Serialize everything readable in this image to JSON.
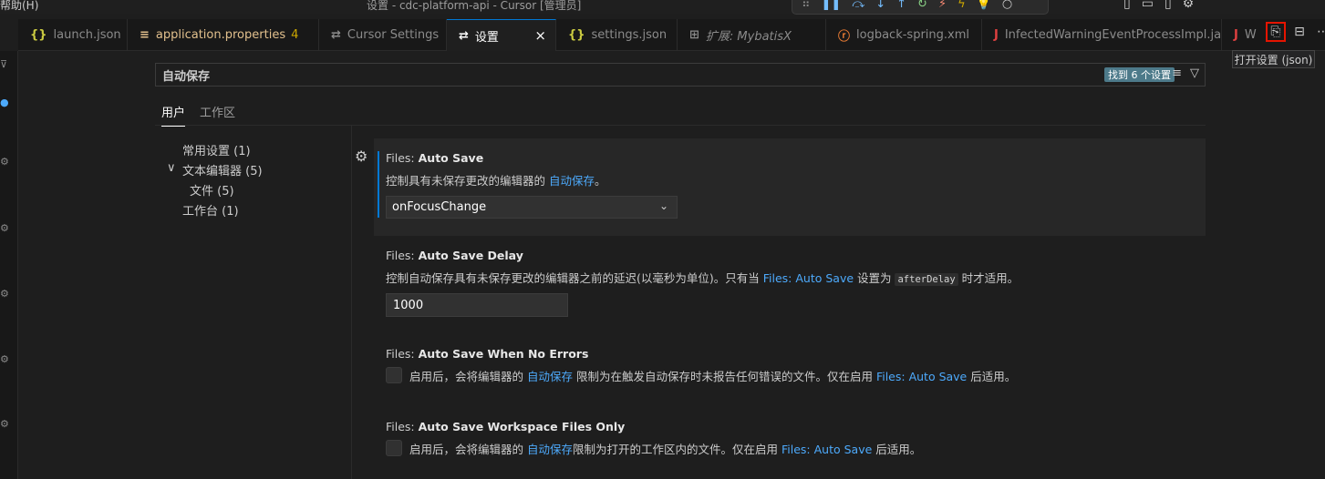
{
  "titlebar": {
    "menu": "帮助(H)",
    "title": "设置 - cdc-platform-api - Cursor [管理员]"
  },
  "tabs": [
    {
      "icon": "{}",
      "label": "launch.json"
    },
    {
      "icon": "≡",
      "label": "application.properties",
      "badge": "4"
    },
    {
      "icon": "⇄",
      "label": "Cursor Settings"
    },
    {
      "icon": "⇄",
      "label": "设置",
      "close": "×"
    },
    {
      "icon": "{}",
      "label": "settings.json"
    },
    {
      "icon": "⊞",
      "label": "扩展: MybatisX"
    },
    {
      "icon": "ⓡ",
      "label": "logback-spring.xml"
    },
    {
      "icon": "J",
      "label": "InfectedWarningEventProcessImpl.java"
    },
    {
      "icon": "J",
      "label": "W"
    }
  ],
  "editor_actions": {
    "tooltip": "打开设置 (json)"
  },
  "search": {
    "value": "自动保存",
    "found": "找到 6 个设置"
  },
  "scopes": {
    "user": "用户",
    "workspace": "工作区"
  },
  "toc": {
    "common": "常用设置 (1)",
    "text_editor_chevron": "∨",
    "text_editor": "文本编辑器 (5)",
    "files": "文件 (5)",
    "workbench": "工作台 (1)"
  },
  "settings": [
    {
      "category": "Files: ",
      "name": "Auto Save",
      "desc_pre": "控制具有未保存更改的编辑器的 ",
      "desc_link": "自动保存",
      "desc_post": "。",
      "value": "onFocusChange"
    },
    {
      "category": "Files: ",
      "name": "Auto Save Delay",
      "desc_pre": "控制自动保存具有未保存更改的编辑器之前的延迟(以毫秒为单位)。只有当 ",
      "desc_link": "Files: Auto Save",
      "desc_mid": " 设置为 ",
      "desc_code": "afterDelay",
      "desc_post": " 时才适用。",
      "value": "1000"
    },
    {
      "category": "Files: ",
      "name": "Auto Save When No Errors",
      "desc_pre": "启用后，会将编辑器的 ",
      "desc_link": "自动保存",
      "desc_mid": " 限制为在触发自动保存时未报告任何错误的文件。仅在启用 ",
      "desc_link2": "Files: Auto Save",
      "desc_post": " 后适用。"
    },
    {
      "category": "Files: ",
      "name": "Auto Save Workspace Files Only",
      "desc_pre": "启用后，会将编辑器的 ",
      "desc_link": "自动保存",
      "desc_mid": "限制为打开的工作区内的文件。仅在启用 ",
      "desc_link2": "Files: Auto Save",
      "desc_post": " 后适用。"
    }
  ],
  "colors": {
    "accent": "#0078d4",
    "link": "#4daafc",
    "highlight_box": "#e51400"
  }
}
